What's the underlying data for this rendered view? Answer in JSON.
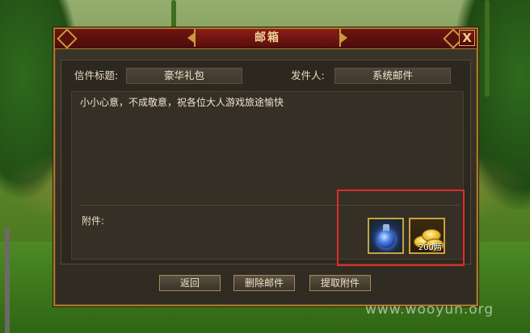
{
  "window": {
    "title": "邮箱",
    "close_label": "X"
  },
  "mail": {
    "subject_label": "信件标题:",
    "subject_value": "豪华礼包",
    "sender_label": "发件人:",
    "sender_value": "系统邮件",
    "body": "小小心意，不成敬意，祝各位大人游戏旅途愉快",
    "attachments_label": "附件:",
    "attachments": [
      {
        "icon": "potion-flask-icon",
        "quantity": ""
      },
      {
        "icon": "gold-coins-icon",
        "quantity": "200两"
      }
    ]
  },
  "buttons": {
    "back": "返回",
    "delete": "删除邮件",
    "extract": "提取附件"
  },
  "watermark": "www.wooyun.org",
  "colors": {
    "frame_gold": "#a8792c",
    "title_red": "#6e1512",
    "highlight_red": "#e02a2a"
  }
}
